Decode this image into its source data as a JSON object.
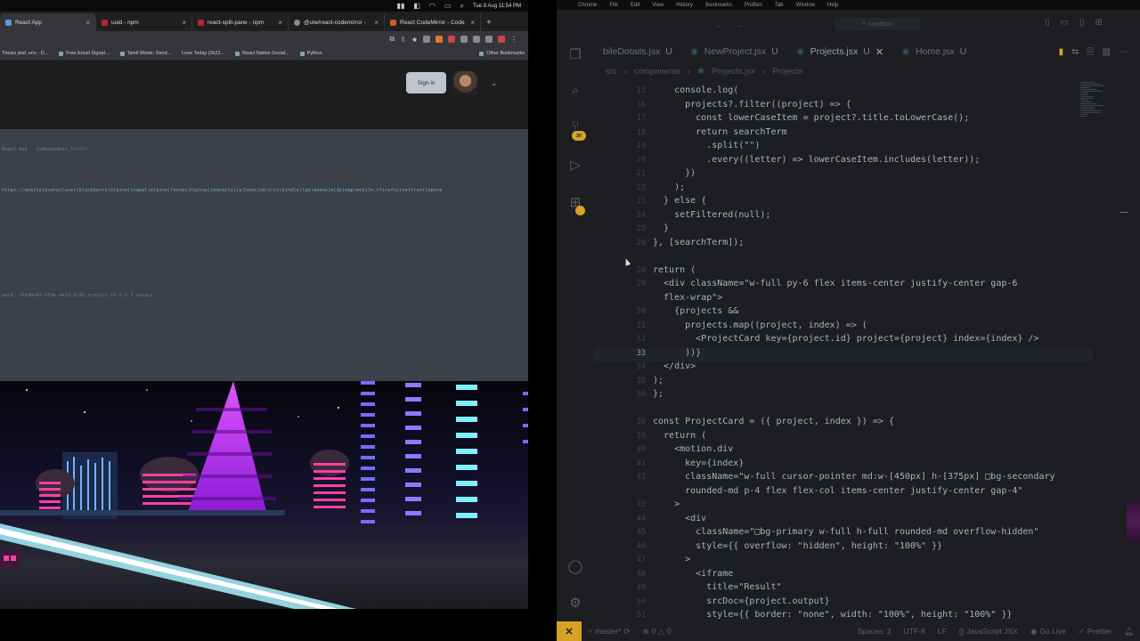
{
  "mac_menubar_left": {
    "date_time": "Tue 8 Aug  11:54 PM"
  },
  "chrome": {
    "tabs": [
      {
        "label": "React App",
        "active": true
      },
      {
        "label": "uuid - npm",
        "active": false
      },
      {
        "label": "react-split-pane - npm",
        "active": false
      },
      {
        "label": "@uiw/react-codemirror -",
        "active": false
      },
      {
        "label": "React CodeMirror - Code",
        "active": false
      }
    ],
    "new_tab": "+",
    "bookmarks": [
      "Thesis and .env - D...",
      "Free Email Signat...",
      "Tamil Movie: Send...",
      "Love Today (2k22...",
      "React Native Social...",
      "Python"
    ],
    "other_bookmarks": "Other Bookmarks",
    "page": {
      "sign_in_label": "Sign in",
      "mono_line_1": "React App - Codesandbox Scroll",
      "mono_line_2": "https://mobile|avatar|user|blackberry|elaine|compal|elaine|fennec|hiptop|iemobile|ip|hone|od|iris|kindle|lge|maemo|midp|mmp|mobile.+firefox|netfront|opera",
      "mono_line_3": "uuid: 2f9d8e43-9f9e-4a1d-8c2b  project.id  0  1  2  output"
    }
  },
  "vscode": {
    "menu": [
      "Chrome",
      "File",
      "Edit",
      "View",
      "History",
      "Bookmarks",
      "Profiles",
      "Tab",
      "Window",
      "Help"
    ],
    "command_center": "sandbox",
    "activity_badges": {
      "source_control": "30"
    },
    "tabs": [
      {
        "label": "bileDotails.jsx",
        "status": "U",
        "active": false
      },
      {
        "label": "NewProject.jsx",
        "status": "U",
        "active": false
      },
      {
        "label": "Projects.jsx",
        "status": "U",
        "active": true
      },
      {
        "label": "Home.jsx",
        "status": "U",
        "active": false
      }
    ],
    "breadcrumb": [
      "src",
      "components",
      "Projects.jsx",
      "Projects"
    ],
    "code_lines": [
      {
        "num": "15",
        "text": "    console.log("
      },
      {
        "num": "16",
        "text": "      projects?.filter((project) => {"
      },
      {
        "num": "17",
        "text": "        const lowerCaseItem = project?.title.toLowerCase();"
      },
      {
        "num": "18",
        "text": "        return searchTerm"
      },
      {
        "num": "19",
        "text": "          .split(\"\")"
      },
      {
        "num": "20",
        "text": "          .every((letter) => lowerCaseItem.includes(letter));"
      },
      {
        "num": "21",
        "text": "      })"
      },
      {
        "num": "22",
        "text": "    );"
      },
      {
        "num": "23",
        "text": "  } else {"
      },
      {
        "num": "24",
        "text": "    setFiltered(null);"
      },
      {
        "num": "25",
        "text": "  }"
      },
      {
        "num": "26",
        "text": "}, [searchTerm]);"
      },
      {
        "num": "",
        "text": ""
      },
      {
        "num": "28",
        "text": "return ("
      },
      {
        "num": "29",
        "text": "  <div className=\"w-full py-6 flex items-center justify-center gap-6"
      },
      {
        "num": "",
        "text": "  flex-wrap\">"
      },
      {
        "num": "30",
        "text": "    {projects &&"
      },
      {
        "num": "31",
        "text": "      projects.map((project, index) => ("
      },
      {
        "num": "32",
        "text": "        <ProjectCard key={project.id} project={project} index={index} />"
      },
      {
        "num": "33",
        "text": "      ))}"
      },
      {
        "num": "34",
        "text": "  </div>"
      },
      {
        "num": "35",
        "text": ");"
      },
      {
        "num": "36",
        "text": "};"
      },
      {
        "num": "",
        "text": ""
      },
      {
        "num": "38",
        "text": "const ProjectCard = ({ project, index }) => {"
      },
      {
        "num": "39",
        "text": "  return ("
      },
      {
        "num": "40",
        "text": "    <motion.div"
      },
      {
        "num": "41",
        "text": "      key={index}"
      },
      {
        "num": "42",
        "text": "      className=\"w-full cursor-pointer md:w-[450px] h-[375px] □bg-secondary"
      },
      {
        "num": "",
        "text": "      rounded-md p-4 flex flex-col items-center justify-center gap-4\""
      },
      {
        "num": "43",
        "text": "    >"
      },
      {
        "num": "44",
        "text": "      <div"
      },
      {
        "num": "45",
        "text": "        className=\"□bg-primary w-full h-full rounded-md overflow-hidden\""
      },
      {
        "num": "46",
        "text": "        style={{ overflow: \"hidden\", height: \"100%\" }}"
      },
      {
        "num": "47",
        "text": "      >"
      },
      {
        "num": "48",
        "text": "        <iframe"
      },
      {
        "num": "49",
        "text": "          title=\"Result\""
      },
      {
        "num": "50",
        "text": "          srcDoc={project.output}"
      },
      {
        "num": "51",
        "text": "          style={{ border: \"none\", width: \"100%\", height: \"100%\" }}"
      }
    ],
    "status": {
      "branch": "master*",
      "sync": "⟳",
      "errors": "0",
      "warnings": "0",
      "spaces": "Spaces: 2",
      "encoding": "UTF-8",
      "eol": "LF",
      "language": "JavaScript JSX",
      "live": "Go Live",
      "prettier": "Prettier"
    }
  }
}
